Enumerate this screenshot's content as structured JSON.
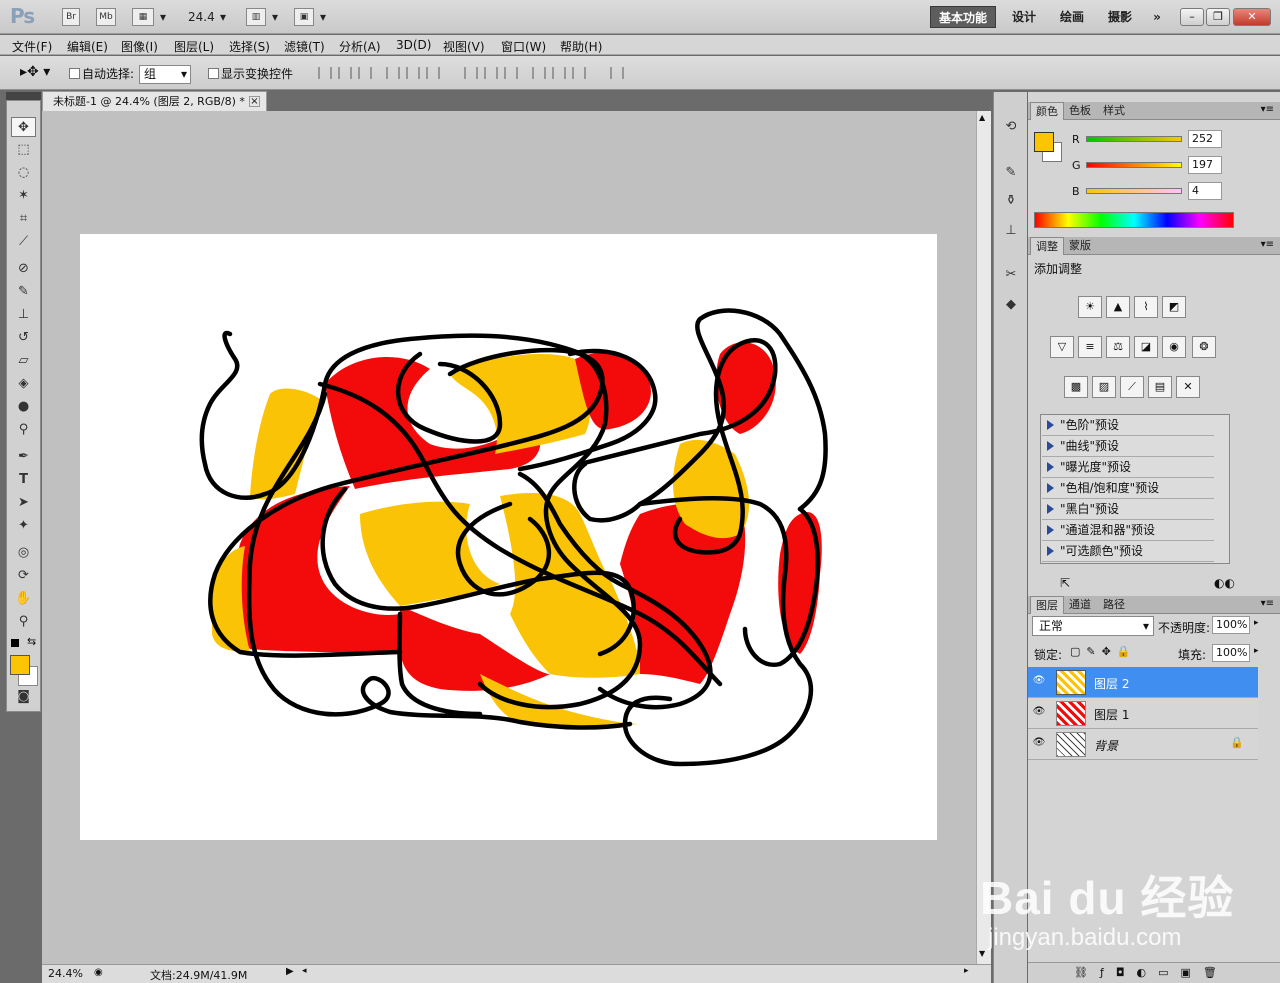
{
  "titlebar": {
    "app_logo": "Ps",
    "br": "Br",
    "mb": "Mb",
    "zoom": "24.4",
    "workspaces": [
      "基本功能",
      "设计",
      "绘画",
      "摄影"
    ],
    "more": "»"
  },
  "menubar": [
    "文件(F)",
    "编辑(E)",
    "图像(I)",
    "图层(L)",
    "选择(S)",
    "滤镜(T)",
    "分析(A)",
    "3D(D)",
    "视图(V)",
    "窗口(W)",
    "帮助(H)"
  ],
  "options": {
    "auto_select_label": "自动选择:",
    "auto_select_value": "组",
    "show_transform_label": "显示变换控件"
  },
  "document": {
    "tab_title": "未标题-1 @ 24.4% (图层 2, RGB/8) *",
    "status_zoom": "24.4%",
    "status_doc": "文档:24.9M/41.9M"
  },
  "color_panel": {
    "tabs": [
      "颜色",
      "色板",
      "样式"
    ],
    "foreground": "#fcc504",
    "r_label": "R",
    "g_label": "G",
    "b_label": "B",
    "r": "252",
    "g": "197",
    "b": "4"
  },
  "adjust_panel": {
    "tabs": [
      "调整",
      "蒙版"
    ],
    "heading": "添加调整",
    "presets": [
      "\"色阶\"预设",
      "\"曲线\"预设",
      "\"曝光度\"预设",
      "\"色相/饱和度\"预设",
      "\"黑白\"预设",
      "\"通道混和器\"预设",
      "\"可选颜色\"预设"
    ]
  },
  "layers_panel": {
    "tabs": [
      "图层",
      "通道",
      "路径"
    ],
    "blend_mode": "正常",
    "opacity_label": "不透明度:",
    "opacity": "100%",
    "lock_label": "锁定:",
    "fill_label": "填充:",
    "fill": "100%",
    "layers": [
      {
        "name": "图层 2",
        "selected": true
      },
      {
        "name": "图层 1",
        "selected": false
      },
      {
        "name": "背景",
        "selected": false
      }
    ]
  },
  "watermark": {
    "brand": "Bai du 经验",
    "url": "jingyan.baidu.com"
  },
  "colors": {
    "red": "#f30b0b",
    "yellow": "#fac305",
    "selection": "#3f8ef0"
  }
}
